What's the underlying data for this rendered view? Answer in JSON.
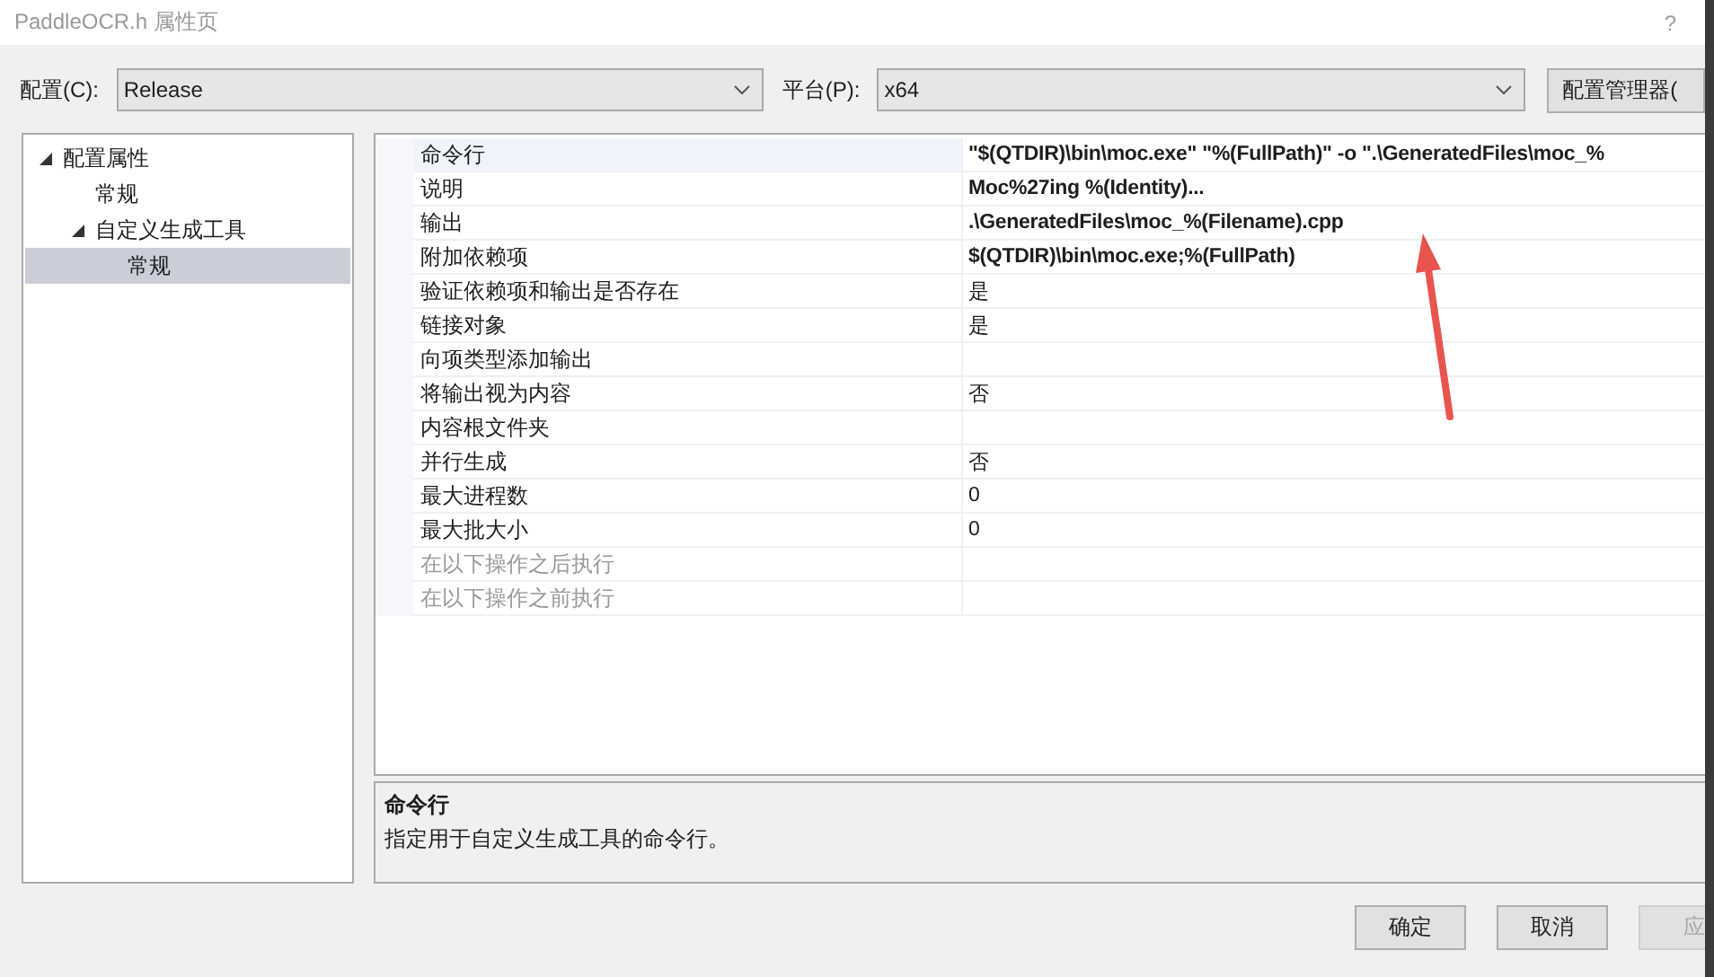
{
  "window": {
    "title": "PaddleOCR.h 属性页",
    "help": "?"
  },
  "config": {
    "label": "配置(C):",
    "value": "Release"
  },
  "platform": {
    "label": "平台(P):",
    "value": "x64"
  },
  "config_manager_button": "配置管理器(",
  "tree": [
    {
      "label": "配置属性",
      "expanded": true,
      "selected": false,
      "children": [
        {
          "label": "常规",
          "selected": false
        },
        {
          "label": "自定义生成工具",
          "expanded": true,
          "selected": false,
          "children": [
            {
              "label": "常规",
              "selected": true
            }
          ]
        }
      ]
    }
  ],
  "properties": [
    {
      "name": "命令行",
      "value": "\"$(QTDIR)\\bin\\moc.exe\" \"%(FullPath)\" -o \".\\GeneratedFiles\\moc_%",
      "modified": true,
      "disabled": false,
      "selected": true
    },
    {
      "name": "说明",
      "value": "Moc%27ing %(Identity)...",
      "modified": true,
      "disabled": false,
      "selected": false
    },
    {
      "name": "输出",
      "value": ".\\GeneratedFiles\\moc_%(Filename).cpp",
      "modified": true,
      "disabled": false,
      "selected": false
    },
    {
      "name": "附加依赖项",
      "value": "$(QTDIR)\\bin\\moc.exe;%(FullPath)",
      "modified": true,
      "disabled": false,
      "selected": false
    },
    {
      "name": "验证依赖项和输出是否存在",
      "value": "是",
      "modified": false,
      "disabled": false,
      "selected": false
    },
    {
      "name": "链接对象",
      "value": "是",
      "modified": false,
      "disabled": false,
      "selected": false
    },
    {
      "name": "向项类型添加输出",
      "disabled": false,
      "selected": false
    },
    {
      "name": "将输出视为内容",
      "value": "否",
      "modified": false,
      "disabled": false,
      "selected": false
    },
    {
      "name": "内容根文件夹",
      "disabled": false,
      "selected": false
    },
    {
      "name": "并行生成",
      "value": "否",
      "modified": false,
      "disabled": false,
      "selected": false
    },
    {
      "name": "最大进程数",
      "value": "0",
      "modified": false,
      "disabled": false,
      "selected": false
    },
    {
      "name": "最大批大小",
      "value": "0",
      "modified": false,
      "disabled": false,
      "selected": false
    },
    {
      "name": "在以下操作之后执行",
      "disabled": true,
      "selected": false
    },
    {
      "name": "在以下操作之前执行",
      "disabled": true,
      "selected": false
    }
  ],
  "description": {
    "title": "命令行",
    "text": "指定用于自定义生成工具的命令行。"
  },
  "buttons": [
    {
      "label": "确定",
      "disabled": false
    },
    {
      "label": "取消",
      "disabled": false
    },
    {
      "label": "应",
      "disabled": true
    }
  ]
}
